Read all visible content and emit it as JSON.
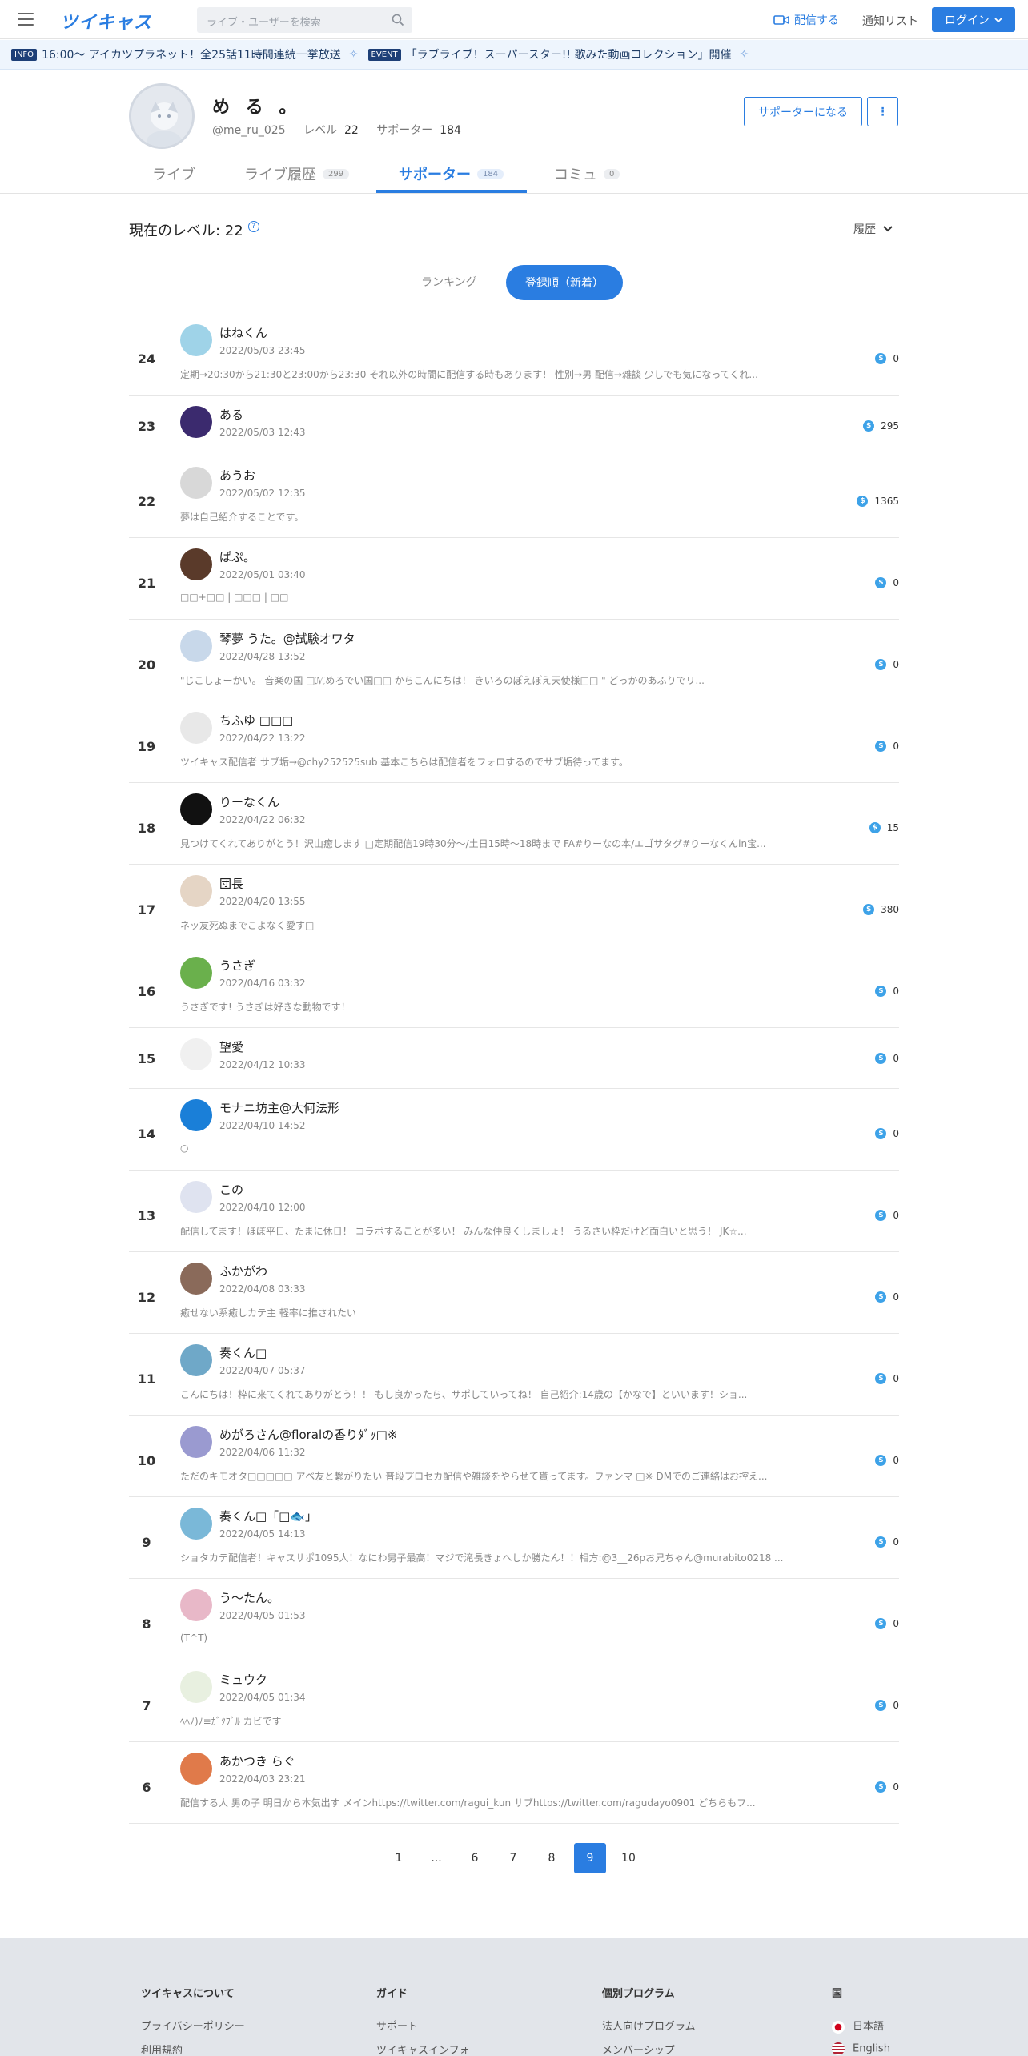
{
  "header": {
    "logo": "ツイキャス",
    "search_placeholder": "ライブ・ユーザーを検索",
    "broadcast": "配信する",
    "notification_list": "通知リスト",
    "login": "ログイン"
  },
  "ticker": [
    {
      "tag": "INFO",
      "text": "16:00〜 アイカツプラネット！全25話11時間連続一挙放送"
    },
    {
      "tag": "EVENT",
      "text": "「ラブライブ！スーパースター!! 歌みた動画コレクション」開催"
    }
  ],
  "profile": {
    "name": "め る 。",
    "user_id": "@me_ru_025",
    "level_label": "レベル",
    "level": "22",
    "supporters_label": "サポーター",
    "supporters": "184",
    "become_supporter": "サポーターになる",
    "more": "⋮"
  },
  "tabs": [
    {
      "label": "ライブ",
      "count": ""
    },
    {
      "label": "ライブ履歴",
      "count": "299"
    },
    {
      "label": "サポーター",
      "count": "184"
    },
    {
      "label": "コミュ",
      "count": "0"
    }
  ],
  "level_section": {
    "label": "現在のレベル: 22",
    "help": "?",
    "history": "履歴"
  },
  "segment": {
    "ranking": "ランキング",
    "newest": "登録順（新着）"
  },
  "supporters": [
    {
      "rank": "24",
      "name": "はねくん",
      "date": "2022/05/03 23:45",
      "bio": "定期→20:30から21:30と23:00から23:30 それ以外の時間に配信する時もあります！ 性別→男 配信→雑談 少しでも気になってくれ...",
      "score": "0",
      "avatar_color": "#9fd3e8"
    },
    {
      "rank": "23",
      "name": "ある",
      "date": "2022/05/03 12:43",
      "bio": "",
      "score": "295",
      "avatar_color": "#3b2a6e"
    },
    {
      "rank": "22",
      "name": "あうお",
      "date": "2022/05/02 12:35",
      "bio": "夢は自己紹介することです。",
      "score": "1365",
      "avatar_color": "#d8d8d8"
    },
    {
      "rank": "21",
      "name": "ぱぷ。",
      "date": "2022/05/01 03:40",
      "bio": "□□+□□ | □□□ | □□",
      "score": "0",
      "avatar_color": "#5a3a2a"
    },
    {
      "rank": "20",
      "name": "琴夢 うた。@試験オワタ",
      "date": "2022/04/28 13:52",
      "bio": "\"じこしょーかい。 音楽の国 □ℳめろでい国□□ からこんにちは！ きいろのぽえぽえ天使様□□ \" どっかのあふりでリ...",
      "score": "0",
      "avatar_color": "#c8d8ea"
    },
    {
      "rank": "19",
      "name": "ちふゆ □□□",
      "date": "2022/04/22 13:22",
      "bio": "ツイキャス配信者 サブ垢→@chy252525sub 基本こちらは配信者をフォロするのでサブ垢待ってます。",
      "score": "0",
      "avatar_color": "#e8e8e8"
    },
    {
      "rank": "18",
      "name": "りーなくん",
      "date": "2022/04/22 06:32",
      "bio": "見つけてくれてありがとう！沢山癒します □定期配信19時30分〜/土日15時〜18時まで FA#りーなの本/エゴサタグ#りーなくんin宝...",
      "score": "15",
      "avatar_color": "#111111"
    },
    {
      "rank": "17",
      "name": "団長",
      "date": "2022/04/20 13:55",
      "bio": "ネッ友死ぬまでこよなく愛す□",
      "score": "380",
      "avatar_color": "#e5d5c5"
    },
    {
      "rank": "16",
      "name": "うさぎ",
      "date": "2022/04/16 03:32",
      "bio": "うさぎです! うさぎは好きな動物です！",
      "score": "0",
      "avatar_color": "#6ab04c"
    },
    {
      "rank": "15",
      "name": "望愛",
      "date": "2022/04/12 10:33",
      "bio": "",
      "score": "0",
      "avatar_color": "#f0f0f0"
    },
    {
      "rank": "14",
      "name": "モナニ坊主@大何法形",
      "date": "2022/04/10 14:52",
      "bio": "○",
      "score": "0",
      "avatar_color": "#1a7fd8"
    },
    {
      "rank": "13",
      "name": "この",
      "date": "2022/04/10 12:00",
      "bio": "配信してます！ほぼ平日、たまに休日！ コラボすることが多い！ みんな仲良くしましょ！ うるさい枠だけど面白いと思う！ JK☆...",
      "score": "0",
      "avatar_color": "#dfe3f0"
    },
    {
      "rank": "12",
      "name": "ふかがわ",
      "date": "2022/04/08 03:33",
      "bio": "癒せない系癒しカテ主 軽率に推されたい",
      "score": "0",
      "avatar_color": "#8a6a5a"
    },
    {
      "rank": "11",
      "name": "奏くん□",
      "date": "2022/04/07 05:37",
      "bio": "こんにちは！枠に来てくれてありがとう！！ もし良かったら、サポしていってね！ 自己紹介:14歳の【かなで】といいます！ショ...",
      "score": "0",
      "avatar_color": "#6fa8c8"
    },
    {
      "rank": "10",
      "name": "めがろさん@floralの香りﾀﾞｯ□※",
      "date": "2022/04/06 11:32",
      "bio": "ただのキモオタ□□□□□ アベ友と繋がりたい 普段プロセカ配信や雑談をやらせて貰ってます。ファンマ □※ DMでのご連絡はお控え...",
      "score": "0",
      "avatar_color": "#9a9ad0"
    },
    {
      "rank": "9",
      "name": "奏くん□「□🐟」",
      "date": "2022/04/05 14:13",
      "bio": "ショタカテ配信者！キャスサポ1095人！なにわ男子最高！マジで滝長きょへしか勝たん！！相方:@3__26pお兄ちゃん@murabito0218 ...",
      "score": "0",
      "avatar_color": "#7ab8d8"
    },
    {
      "rank": "8",
      "name": "う〜たん。",
      "date": "2022/04/05 01:53",
      "bio": "(T^T)",
      "score": "0",
      "avatar_color": "#e8b8c8"
    },
    {
      "rank": "7",
      "name": "ミュウク",
      "date": "2022/04/05 01:34",
      "bio": "ﾍﾍﾉ)ﾉ≡ｶﾞｸﾌﾞﾙ カビです",
      "score": "0",
      "avatar_color": "#e8f0e0"
    },
    {
      "rank": "6",
      "name": "あかつき らぐ",
      "date": "2022/04/03 23:21",
      "bio": "配信する人 男の子 明日から本気出す メインhttps://twitter.com/ragui_kun サブhttps://twitter.com/ragudayo0901 どちらもフ...",
      "score": "0",
      "avatar_color": "#e07a4a"
    }
  ],
  "pagination": [
    "1",
    "...",
    "6",
    "7",
    "8",
    "9",
    "10"
  ],
  "pagination_active": "9",
  "footer": {
    "columns": [
      {
        "heading": "ツイキャスについて",
        "items": [
          "プライバシーポリシー",
          "利用規約"
        ]
      },
      {
        "heading": "ガイド",
        "items": [
          "サポート",
          "ツイキャスインフォ"
        ]
      },
      {
        "heading": "個別プログラム",
        "items": [
          "法人向けプログラム",
          "メンバーシップ"
        ]
      },
      {
        "heading": "国",
        "items": [
          "日本語",
          "English"
        ]
      }
    ]
  },
  "colors": {
    "accent": "#2a7de1",
    "coin": "#3da2e8"
  }
}
